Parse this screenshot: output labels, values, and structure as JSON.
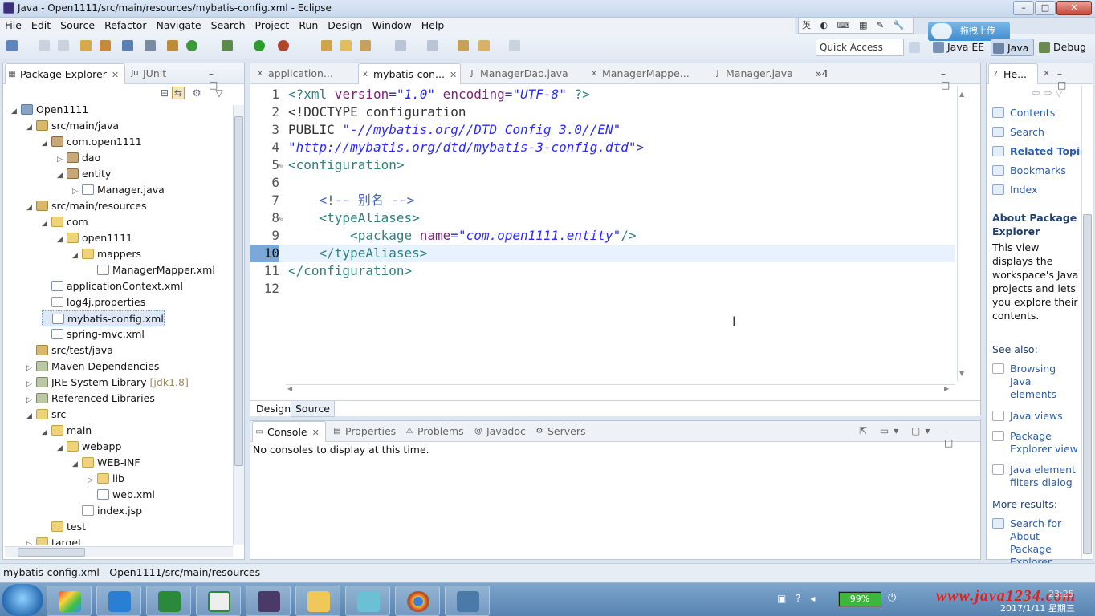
{
  "window": {
    "title": "Java - Open1111/src/main/resources/mybatis-config.xml - Eclipse",
    "controls": [
      "–",
      "□",
      "✕"
    ]
  },
  "ime": {
    "label": "英",
    "upload_label": "拖拽上传"
  },
  "menu": [
    "File",
    "Edit",
    "Source",
    "Refactor",
    "Navigate",
    "Search",
    "Project",
    "Run",
    "Design",
    "Window",
    "Help"
  ],
  "toolbar": {
    "quick_access_placeholder": "Quick Access",
    "perspectives": [
      "Java EE",
      "Java",
      "Debug"
    ]
  },
  "package_explorer": {
    "tabs": [
      {
        "label": "Package Explorer",
        "close": "✕"
      },
      {
        "label": "JUnit"
      }
    ],
    "tree": [
      {
        "label": "Open1111",
        "icon": "project-icon",
        "arrow": "◢"
      },
      {
        "label": "src/main/java",
        "icon": "source-folder-icon",
        "arrow": "◢"
      },
      {
        "label": "com.open1111",
        "icon": "package-icon",
        "arrow": "◢"
      },
      {
        "label": "dao",
        "icon": "package-icon",
        "arrow": "▷"
      },
      {
        "label": "entity",
        "icon": "package-icon",
        "arrow": "◢"
      },
      {
        "label": "Manager.java",
        "icon": "java-file-icon",
        "arrow": "▷"
      },
      {
        "label": "src/main/resources",
        "icon": "source-folder-icon",
        "arrow": "◢"
      },
      {
        "label": "com",
        "icon": "folder-icon",
        "arrow": "◢"
      },
      {
        "label": "open1111",
        "icon": "folder-icon",
        "arrow": "◢"
      },
      {
        "label": "mappers",
        "icon": "folder-icon",
        "arrow": "◢"
      },
      {
        "label": "ManagerMapper.xml",
        "icon": "xml-file-icon",
        "arrow": ""
      },
      {
        "label": "applicationContext.xml",
        "icon": "xml-file-icon",
        "arrow": ""
      },
      {
        "label": "log4j.properties",
        "icon": "properties-file-icon",
        "arrow": ""
      },
      {
        "label": "mybatis-config.xml",
        "icon": "xml-file-icon",
        "arrow": ""
      },
      {
        "label": "spring-mvc.xml",
        "icon": "xml-file-icon",
        "arrow": ""
      },
      {
        "label": "src/test/java",
        "icon": "source-folder-icon",
        "arrow": ""
      },
      {
        "label": "Maven Dependencies",
        "icon": "library-icon",
        "arrow": "▷"
      },
      {
        "label": "JRE System Library",
        "icon": "library-icon",
        "arrow": "▷",
        "suffix": "[jdk1.8]"
      },
      {
        "label": "Referenced Libraries",
        "icon": "library-icon",
        "arrow": "▷"
      },
      {
        "label": "src",
        "icon": "folder-icon",
        "arrow": "◢"
      },
      {
        "label": "main",
        "icon": "folder-icon",
        "arrow": "◢"
      },
      {
        "label": "webapp",
        "icon": "folder-icon",
        "arrow": "◢"
      },
      {
        "label": "WEB-INF",
        "icon": "folder-icon",
        "arrow": "◢"
      },
      {
        "label": "lib",
        "icon": "folder-icon",
        "arrow": "▷"
      },
      {
        "label": "web.xml",
        "icon": "xml-file-icon",
        "arrow": ""
      },
      {
        "label": "index.jsp",
        "icon": "jsp-file-icon",
        "arrow": ""
      },
      {
        "label": "test",
        "icon": "folder-icon",
        "arrow": ""
      },
      {
        "label": "target",
        "icon": "folder-icon",
        "arrow": "▷"
      }
    ],
    "selected_index": 13
  },
  "editor": {
    "tabs": [
      {
        "label": "application..."
      },
      {
        "label": "mybatis-con...",
        "active": true,
        "close": "✕"
      },
      {
        "label": "ManagerDao.java"
      },
      {
        "label": "ManagerMappe..."
      },
      {
        "label": "Manager.java"
      }
    ],
    "overflow": "»4",
    "lines": [
      {
        "n": "1",
        "text": "<?xml version=\"1.0\" encoding=\"UTF-8\" ?>"
      },
      {
        "n": "2",
        "text": "<!DOCTYPE configuration"
      },
      {
        "n": "3",
        "text": "PUBLIC \"-//mybatis.org//DTD Config 3.0//EN\""
      },
      {
        "n": "4",
        "text": "\"http://mybatis.org/dtd/mybatis-3-config.dtd\">"
      },
      {
        "n": "5",
        "text": "<configuration>",
        "fold": "⊖"
      },
      {
        "n": "6",
        "text": ""
      },
      {
        "n": "7",
        "text": "    <!-- 别名 -->"
      },
      {
        "n": "8",
        "text": "    <typeAliases>",
        "fold": "⊖"
      },
      {
        "n": "9",
        "text": "        <package name=\"com.open1111.entity\"/>"
      },
      {
        "n": "10",
        "text": "    </typeAliases>",
        "current": true
      },
      {
        "n": "11",
        "text": "</configuration>"
      },
      {
        "n": "12",
        "text": ""
      }
    ],
    "bottom_tabs": [
      "Design",
      "Source"
    ],
    "active_bottom_tab": "Source"
  },
  "console": {
    "tabs": [
      "Console",
      "Properties",
      "Problems",
      "Javadoc",
      "Servers"
    ],
    "close": "✕",
    "message": "No consoles to display at this time."
  },
  "help": {
    "tab_label": "He...",
    "close": "✕",
    "links": [
      "Contents",
      "Search",
      "Related Topics",
      "Bookmarks",
      "Index"
    ],
    "about_title": "About Package Explorer",
    "about_text": "This view displays the workspace's Java projects and lets you explore their contents.",
    "see_also": "See also:",
    "see_also_links": [
      "Browsing Java elements",
      "Java views",
      "Package Explorer view",
      "Java element filters dialog"
    ],
    "more_results": "More results:",
    "more_links": [
      "Search for About Package Explorer"
    ]
  },
  "status_bar": {
    "text": "mybatis-config.xml - Open1111/src/main/resources"
  },
  "taskbar": {
    "battery": "99%",
    "watermark": "www.java1234.com",
    "date": "2017/1/11 星期三",
    "time": "23:25"
  },
  "colors": {
    "accent": "#2a5da8",
    "xml_tag": "#2f7f7f",
    "xml_attr": "#7a1f7a",
    "xml_string": "#2a2aff",
    "comment": "#3f5fbf"
  }
}
